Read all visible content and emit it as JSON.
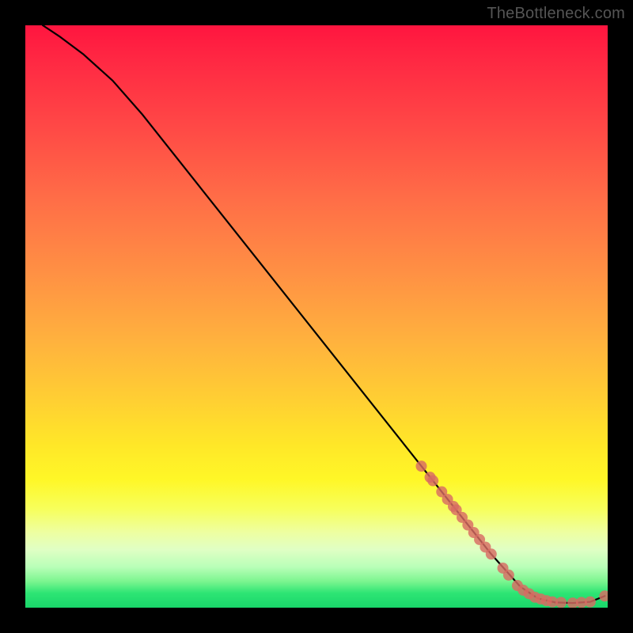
{
  "watermark": "TheBottleneck.com",
  "chart_data": {
    "type": "line",
    "title": "",
    "xlabel": "",
    "ylabel": "",
    "xlim": [
      0,
      100
    ],
    "ylim": [
      0,
      100
    ],
    "grid": false,
    "legend": false,
    "curve": {
      "name": "bottleneck-curve",
      "color": "#000000",
      "x": [
        3,
        6,
        10,
        15,
        20,
        25,
        30,
        35,
        40,
        45,
        50,
        55,
        60,
        65,
        70,
        75,
        80,
        85,
        88,
        91,
        94,
        97,
        99.5
      ],
      "y": [
        100,
        98,
        95,
        90.5,
        84.8,
        78.5,
        72.2,
        65.9,
        59.6,
        53.3,
        47.0,
        40.7,
        34.4,
        28.1,
        21.8,
        15.5,
        9.2,
        3.6,
        1.6,
        0.9,
        0.8,
        1.0,
        2.0
      ]
    },
    "markers": {
      "name": "highlight-points",
      "color": "#d86b63",
      "radius": 7,
      "x": [
        68,
        69.5,
        70,
        71.5,
        72.5,
        73.5,
        74,
        75,
        76,
        77,
        78,
        79,
        80,
        82,
        83,
        84.5,
        85.5,
        86.5,
        87.5,
        88.5,
        89.5,
        90.5,
        92,
        94,
        95.5,
        97,
        99.5
      ],
      "y": [
        24.3,
        22.4,
        21.8,
        19.9,
        18.6,
        17.4,
        16.8,
        15.5,
        14.2,
        12.9,
        11.7,
        10.4,
        9.2,
        6.8,
        5.6,
        3.8,
        3.0,
        2.4,
        1.8,
        1.5,
        1.2,
        1.0,
        0.9,
        0.8,
        0.9,
        1.0,
        2.0
      ]
    }
  }
}
